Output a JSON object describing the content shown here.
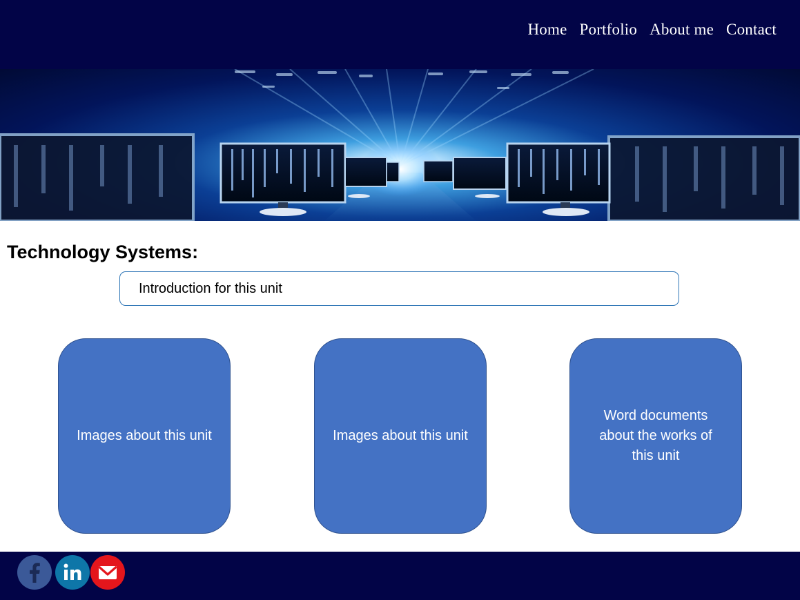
{
  "nav": {
    "items": [
      {
        "label": "Home"
      },
      {
        "label": "Portfolio"
      },
      {
        "label": "About me"
      },
      {
        "label": "Contact"
      }
    ]
  },
  "main": {
    "title": "Technology Systems:",
    "intro": "Introduction for this unit",
    "cards": [
      {
        "label": "Images about this unit"
      },
      {
        "label": "Images about this unit"
      },
      {
        "label": "Word documents about the works of this unit"
      }
    ]
  },
  "footer": {
    "social": [
      {
        "icon": "facebook-icon"
      },
      {
        "icon": "linkedin-icon"
      },
      {
        "icon": "email-icon"
      }
    ]
  },
  "colors": {
    "header_bg": "#020447",
    "card_bg": "#4472c4",
    "intro_border": "#2e75b6",
    "facebook": "#3b5998",
    "linkedin": "#0e76a8",
    "email": "#e4161c"
  }
}
